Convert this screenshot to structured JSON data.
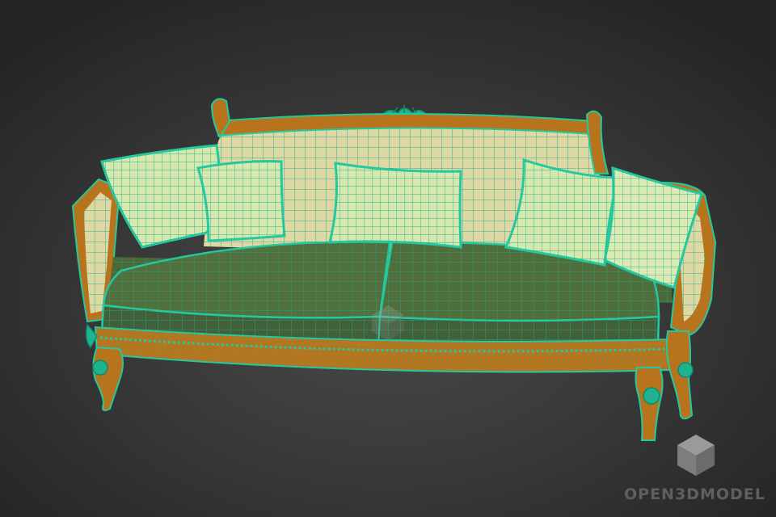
{
  "scene": {
    "subject": "sofa-wireframe-render",
    "colors": {
      "background_top": "#262626",
      "background_mid": "#3d3d3d",
      "background_bottom": "#2a2a2a",
      "frame_wood": "#b8741c",
      "frame_wood_dark": "#8a5a12",
      "wire": "#24c9a0",
      "wire_dark": "#14a37e",
      "upholstery_back": "#ded7a2",
      "pillow": "#d8eab0",
      "seat": "#4f6e3c",
      "seat_dark": "#3f5d31"
    }
  },
  "watermark": {
    "text": "OPEN3DMODEL",
    "logo_icon": "cube-icon",
    "color": "#5f5f5f"
  }
}
